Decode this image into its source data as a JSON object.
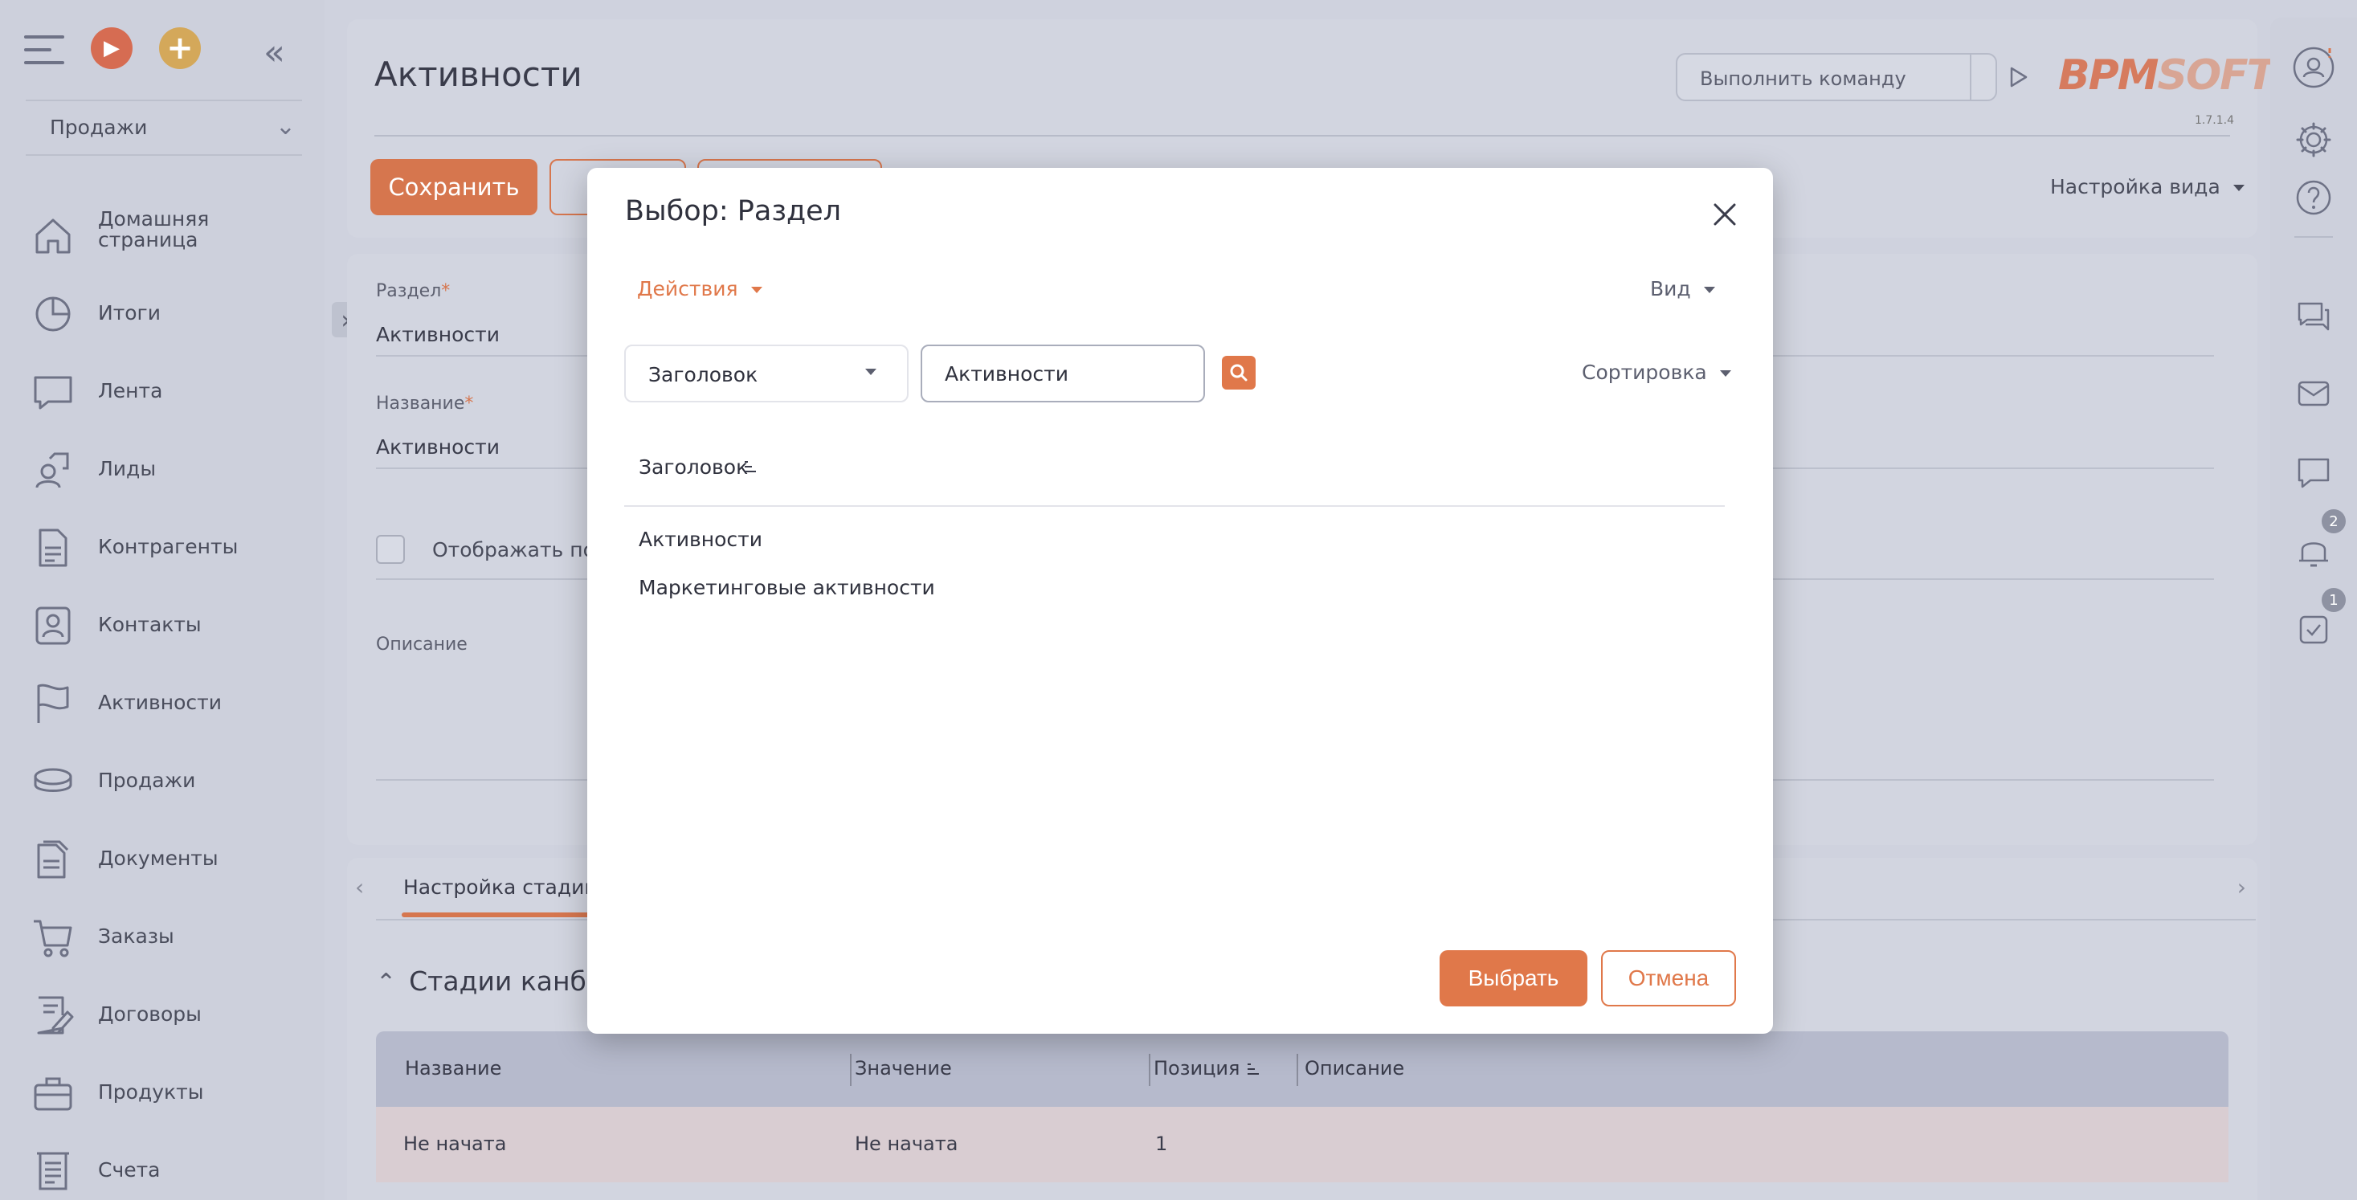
{
  "sidebar": {
    "section_select": "Продажи",
    "items": [
      {
        "label": "Домашняя страница",
        "icon": "home-icon"
      },
      {
        "label": "Итоги",
        "icon": "pie-chart-icon"
      },
      {
        "label": "Лента",
        "icon": "feed-icon"
      },
      {
        "label": "Лиды",
        "icon": "leads-icon"
      },
      {
        "label": "Контрагенты",
        "icon": "accounts-icon"
      },
      {
        "label": "Контакты",
        "icon": "contacts-icon"
      },
      {
        "label": "Активности",
        "icon": "flag-icon"
      },
      {
        "label": "Продажи",
        "icon": "sales-icon"
      },
      {
        "label": "Документы",
        "icon": "documents-icon"
      },
      {
        "label": "Заказы",
        "icon": "cart-icon"
      },
      {
        "label": "Договоры",
        "icon": "contract-icon"
      },
      {
        "label": "Продукты",
        "icon": "products-icon"
      },
      {
        "label": "Счета",
        "icon": "invoice-icon"
      }
    ]
  },
  "header": {
    "title": "Активности",
    "command_placeholder": "Выполнить команду",
    "logo_bpm": "BPM",
    "logo_soft": "SOFT",
    "version": "1.7.1.4",
    "save_label": "Сохранить",
    "view_settings": "Настройка вида"
  },
  "form": {
    "section_label": "Раздел",
    "section_value": "Активности",
    "name_label": "Название",
    "name_value": "Активности",
    "show_checkbox_label": "Отображать по у",
    "description_label": "Описание",
    "required_mark": "*"
  },
  "tabs": {
    "active_tab": "Настройка стадий и",
    "section_title": "Стадии канбан-",
    "grid": {
      "columns": [
        "Название",
        "Значение",
        "Позиция",
        "Описание"
      ],
      "rows": [
        [
          "Не начата",
          "Не начата",
          "1",
          ""
        ]
      ]
    }
  },
  "rightbar": {
    "notifications_badge": "2",
    "tasks_badge": "1"
  },
  "modal": {
    "title": "Выбор: Раздел",
    "actions_label": "Действия",
    "view_label": "Вид",
    "filter_column": "Заголовок",
    "search_value": "Активности",
    "sort_label": "Сортировка",
    "column_header": "Заголовок",
    "rows": [
      "Активности",
      "Маркетинговые активности"
    ],
    "select_label": "Выбрать",
    "cancel_label": "Отмена"
  },
  "colors": {
    "accent": "#e0784a",
    "background": "#cfd2de"
  }
}
